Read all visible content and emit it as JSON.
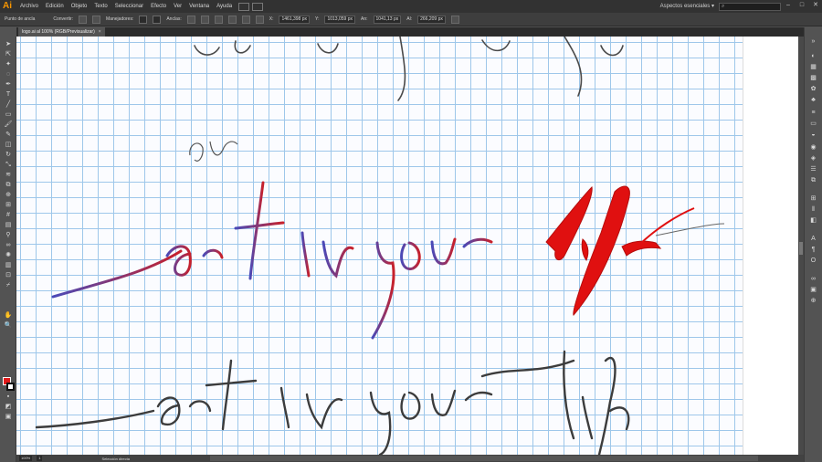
{
  "app": {
    "logo": "Ai"
  },
  "menu": [
    "Archivo",
    "Edición",
    "Objeto",
    "Texto",
    "Seleccionar",
    "Efecto",
    "Ver",
    "Ventana",
    "Ayuda"
  ],
  "workspace": "Aspectos esenciales ▾",
  "controlbar": {
    "anchor_label": "Punto de ancla",
    "convert_label": "Convertir:",
    "handles_label": "Manejadores:",
    "anchors_label": "Anclas:",
    "x_value": "1461,398 px",
    "y_value": "1013,059 px",
    "w_value": "1041,13 px",
    "h_value": "266,209 px"
  },
  "document_tab": {
    "title": "logo.ai al 100% (RGB/Previsualizar)",
    "close": "×"
  },
  "statusbar": {
    "zoom": "100%",
    "page": "1",
    "status": "Selección directa"
  },
  "artwork": {
    "phrase": "art in your life",
    "ink_color": "#3c3c3c",
    "vector_color_start": "#4a4ab8",
    "vector_color_end": "#c8202a",
    "highlight_color": "#e01010"
  },
  "icons": [
    "selection-icon",
    "direct-selection-icon",
    "magic-wand-icon",
    "lasso-icon",
    "pen-icon",
    "type-icon",
    "line-icon",
    "rectangle-icon",
    "paintbrush-icon",
    "pencil-icon",
    "eraser-icon",
    "rotate-icon",
    "scale-icon",
    "warp-icon",
    "free-transform-icon",
    "shape-builder-icon",
    "perspective-icon",
    "mesh-icon",
    "gradient-icon",
    "eyedropper-icon",
    "blend-icon",
    "symbol-sprayer-icon",
    "graph-icon",
    "artboard-icon",
    "slice-icon",
    "hand-icon",
    "zoom-icon"
  ]
}
